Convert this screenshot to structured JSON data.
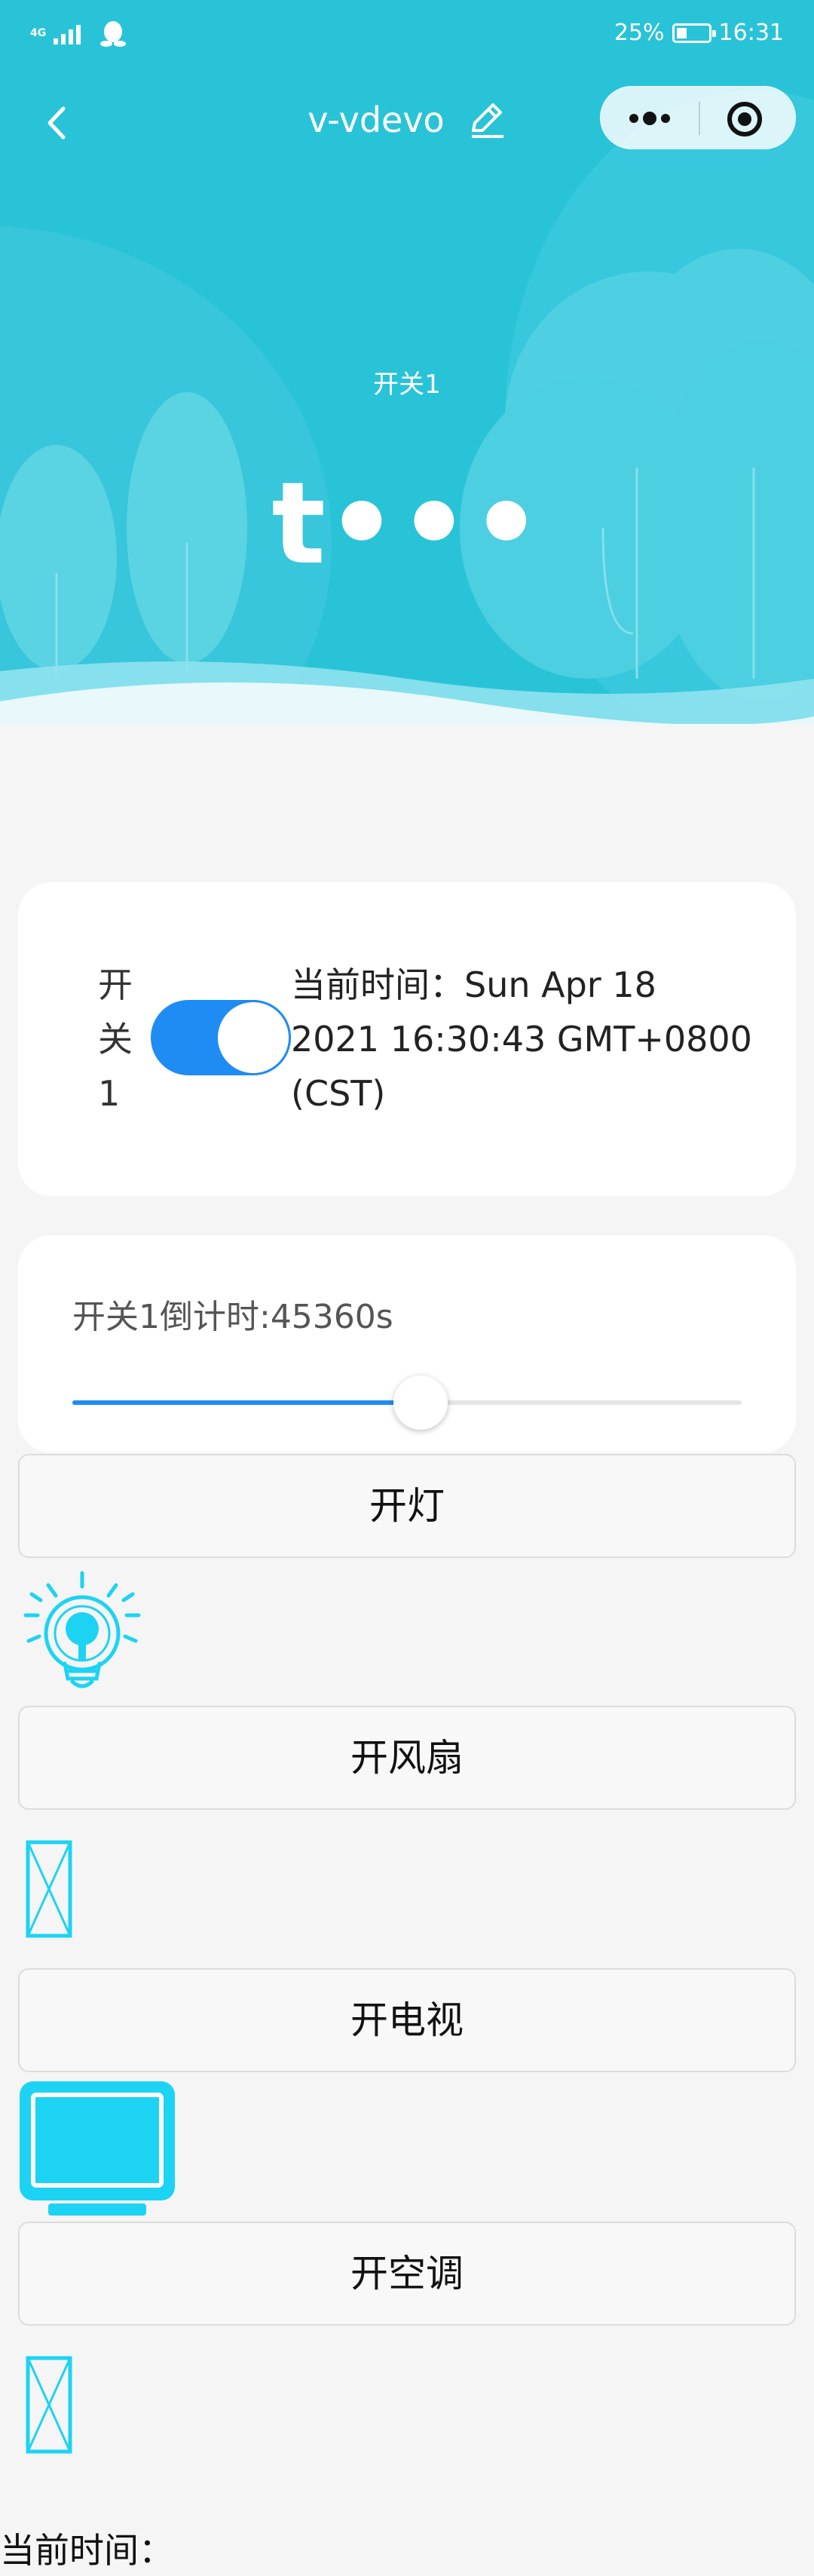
{
  "status_bar": {
    "network": "4G",
    "battery": "25%",
    "time": "16:31"
  },
  "navbar": {
    "title": "v-vdevo"
  },
  "hero": {
    "subtitle": "开关1",
    "value": "t•••"
  },
  "switch_card": {
    "label": "开关1",
    "label_lines": [
      "开",
      "关",
      "1"
    ],
    "toggle_on": true,
    "time_lines": [
      "当前时间：Sun Apr 18",
      "2021 16:30:43 GMT+0800",
      "(CST)"
    ]
  },
  "countdown_card": {
    "label": "开关1倒计时:45360s",
    "slider_fraction": 0.52
  },
  "buttons": {
    "light": "开灯",
    "fan": "开风扇",
    "tv": "开电视",
    "ac": "开空调"
  },
  "icons": {
    "light": "lightbulb-icon",
    "fan": "broken-image-icon",
    "tv": "tv-monitor-icon",
    "ac": "broken-image-icon"
  },
  "footer": {
    "current_time_label": "当前时间："
  },
  "colors": {
    "header_bg": "#29c3d8",
    "toggle_on": "#1f8cf3",
    "icon_cyan": "#1dd3f3"
  }
}
